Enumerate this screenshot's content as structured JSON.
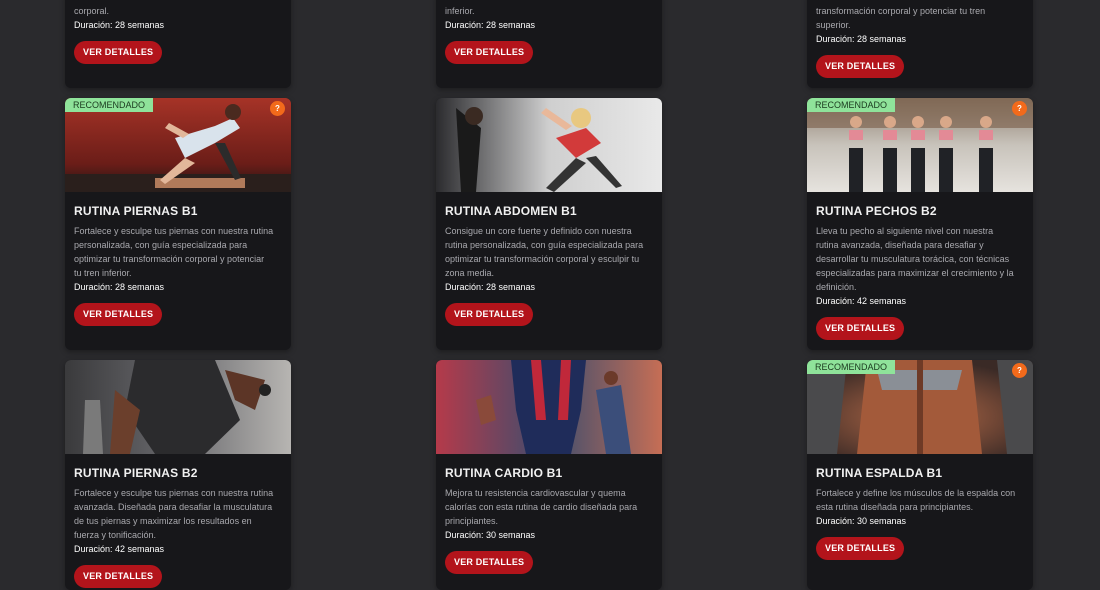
{
  "common": {
    "button_label": "VER DETALLES",
    "badge_label": "RECOMENDADO",
    "help_label": "?"
  },
  "top": [
    {
      "desc": [
        "corporal."
      ],
      "duration": "Duración: 28 semanas"
    },
    {
      "desc": [
        "inferior."
      ],
      "duration": "Duración: 28 semanas"
    },
    {
      "desc": [
        "transformación corporal y potenciar tu tren",
        "superior."
      ],
      "duration": "Duración: 28 semanas"
    }
  ],
  "row1": [
    {
      "title": "RUTINA PIERNAS B1",
      "desc": [
        "Fortalece y esculpe tus piernas con nuestra rutina",
        "personalizada, con guía especializada para",
        "optimizar tu transformación corporal y potenciar",
        "tu tren inferior."
      ],
      "duration": "Duración: 28 semanas"
    },
    {
      "title": "RUTINA ABDOMEN B1",
      "desc": [
        "Consigue un core fuerte y definido con nuestra",
        "rutina personalizada, con guía especializada para",
        "optimizar tu transformación corporal y esculpir tu",
        "zona media."
      ],
      "duration": "Duración: 28 semanas"
    },
    {
      "title": "RUTINA PECHOS B2",
      "desc": [
        "Lleva tu pecho al siguiente nivel con nuestra",
        "rutina avanzada, diseñada para desafiar y",
        "desarrollar tu musculatura torácica, con técnicas",
        "especializadas para maximizar el crecimiento y la",
        "definición."
      ],
      "duration": "Duración: 42 semanas"
    }
  ],
  "row2": [
    {
      "title": "RUTINA PIERNAS B2",
      "desc": [
        "Fortalece y esculpe tus piernas con nuestra rutina",
        "avanzada. Diseñada para desafiar la musculatura",
        "de tus piernas y maximizar los resultados en",
        "fuerza y tonificación."
      ],
      "duration": "Duración: 42 semanas"
    },
    {
      "title": "RUTINA CARDIO B1",
      "desc": [
        "Mejora tu resistencia cardiovascular y quema",
        "calorías con esta rutina de cardio diseñada para",
        "principiantes."
      ],
      "duration": "Duración: 30 semanas"
    },
    {
      "title": "RUTINA ESPALDA B1",
      "desc": [
        "Fortalece y define los músculos de la espalda con",
        "esta rutina diseñada para principiantes."
      ],
      "duration": "Duración: 30 semanas"
    }
  ]
}
